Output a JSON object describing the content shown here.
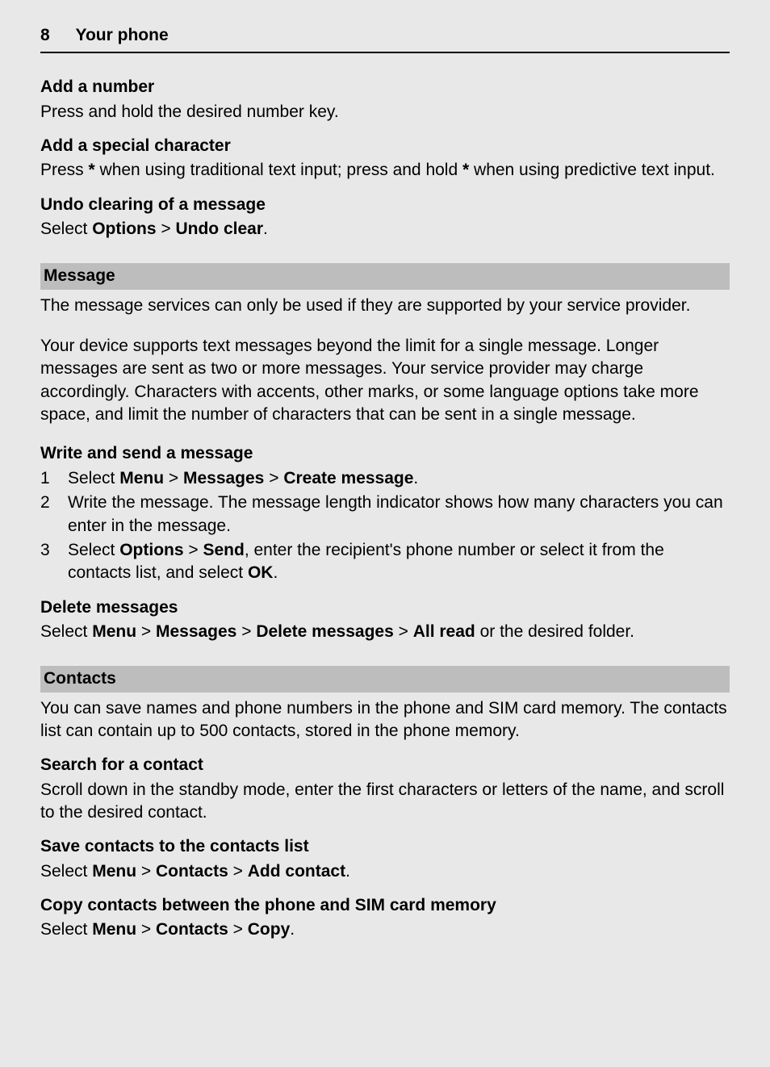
{
  "header": {
    "page_number": "8",
    "title": "Your phone"
  },
  "s1": {
    "h": "Add a number",
    "p": "Press and hold the desired number key."
  },
  "s2": {
    "h": "Add a special character",
    "p_a": "Press ",
    "p_b": "*",
    "p_c": " when using traditional text input; press and hold ",
    "p_d": "*",
    "p_e": " when using predictive text input."
  },
  "s3": {
    "h": "Undo clearing of a message",
    "p_a": "Select ",
    "p_b": "Options",
    "p_c": " > ",
    "p_d": "Undo clear",
    "p_e": "."
  },
  "sec_message": {
    "title": "Message",
    "p1": "The message services can only be used if they are supported by your service provider.",
    "p2": "Your device supports text messages beyond the limit for a single message. Longer messages are sent as two or more messages. Your service provider may charge accordingly. Characters with accents, other marks, or some language options take more space, and limit the number of characters that can be sent in a single message."
  },
  "write": {
    "h": "Write and send a message",
    "step1": {
      "n": "1",
      "a": "Select ",
      "b": "Menu",
      "c": " > ",
      "d": "Messages",
      "e": " > ",
      "f": "Create message",
      "g": "."
    },
    "step2": {
      "n": "2",
      "t": "Write the message. The message length indicator shows how many characters you can enter in the message."
    },
    "step3": {
      "n": "3",
      "a": "Select ",
      "b": "Options",
      "c": " > ",
      "d": "Send",
      "e": ", enter the recipient's phone number or select it from the contacts list, and select ",
      "f": "OK",
      "g": "."
    }
  },
  "delete": {
    "h": "Delete messages",
    "a": "Select ",
    "b": "Menu",
    "c": " > ",
    "d": "Messages",
    "e": " > ",
    "f": "Delete messages",
    "g": " > ",
    "hh": "All read",
    "i": " or the desired folder."
  },
  "sec_contacts": {
    "title": "Contacts",
    "p": "You can save names and phone numbers in the phone and SIM card memory. The contacts list can contain up to 500 contacts, stored in the phone memory."
  },
  "search": {
    "h": "Search for a contact",
    "p": "Scroll down in the standby mode, enter the first characters or letters of the name, and scroll to the desired contact."
  },
  "save": {
    "h": "Save contacts to the contacts list",
    "a": "Select ",
    "b": "Menu",
    "c": " > ",
    "d": "Contacts",
    "e": " > ",
    "f": "Add contact",
    "g": "."
  },
  "copy": {
    "h": "Copy contacts between the phone and SIM card memory",
    "a": "Select ",
    "b": "Menu",
    "c": " > ",
    "d": "Contacts",
    "e": " > ",
    "f": "Copy",
    "g": "."
  }
}
